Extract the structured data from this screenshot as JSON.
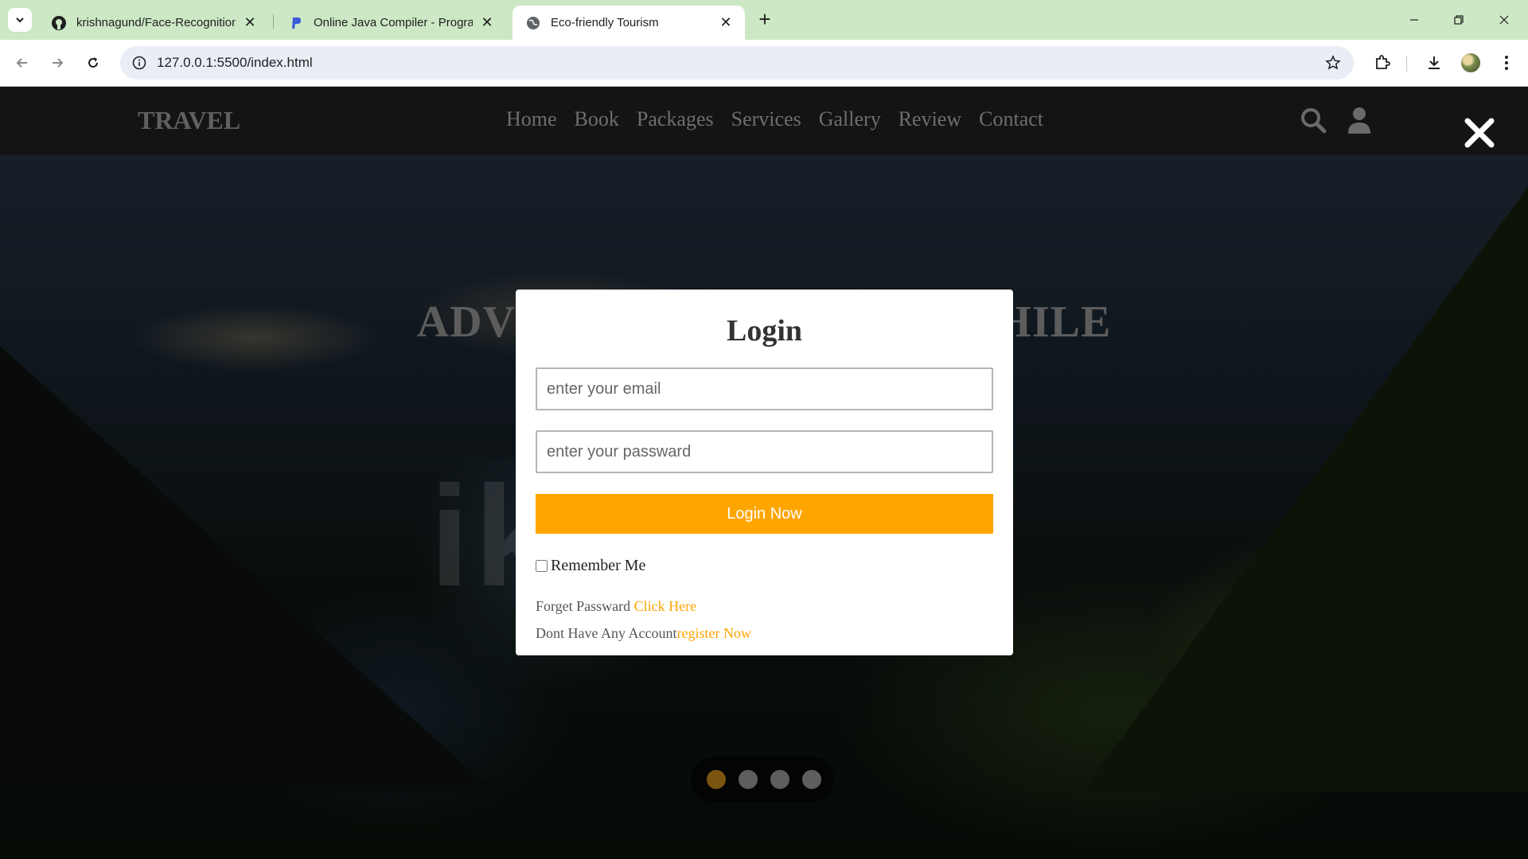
{
  "browser": {
    "tabs": [
      {
        "title": "krishnagund/Face-Recognition-",
        "favicon": "github-icon",
        "active": false
      },
      {
        "title": "Online Java Compiler - Program",
        "favicon": "programiz-icon",
        "active": false
      },
      {
        "title": "Eco-friendly Tourism",
        "favicon": "globe-icon",
        "active": true
      }
    ],
    "url": "127.0.0.1:5500/index.html"
  },
  "header": {
    "logo": "TRAVEL",
    "nav": [
      "Home",
      "Book",
      "Packages",
      "Services",
      "Gallery",
      "Review",
      "Contact"
    ]
  },
  "hero": {
    "heading": "ADVENTURE IS WORTHWHILE",
    "watermark": "ik",
    "slides_total": 4,
    "slide_active": 1
  },
  "login": {
    "title": "Login",
    "email_placeholder": "enter your email",
    "password_placeholder": "enter your passward",
    "button": "Login Now",
    "remember": "Remember Me",
    "forgot_text": "Forget Passward ",
    "forgot_link": "Click Here",
    "register_text": "Dont Have Any Account",
    "register_link": "register Now"
  },
  "colors": {
    "accent": "#ffa500",
    "tabbar": "#cce8c4",
    "header": "#141414"
  }
}
